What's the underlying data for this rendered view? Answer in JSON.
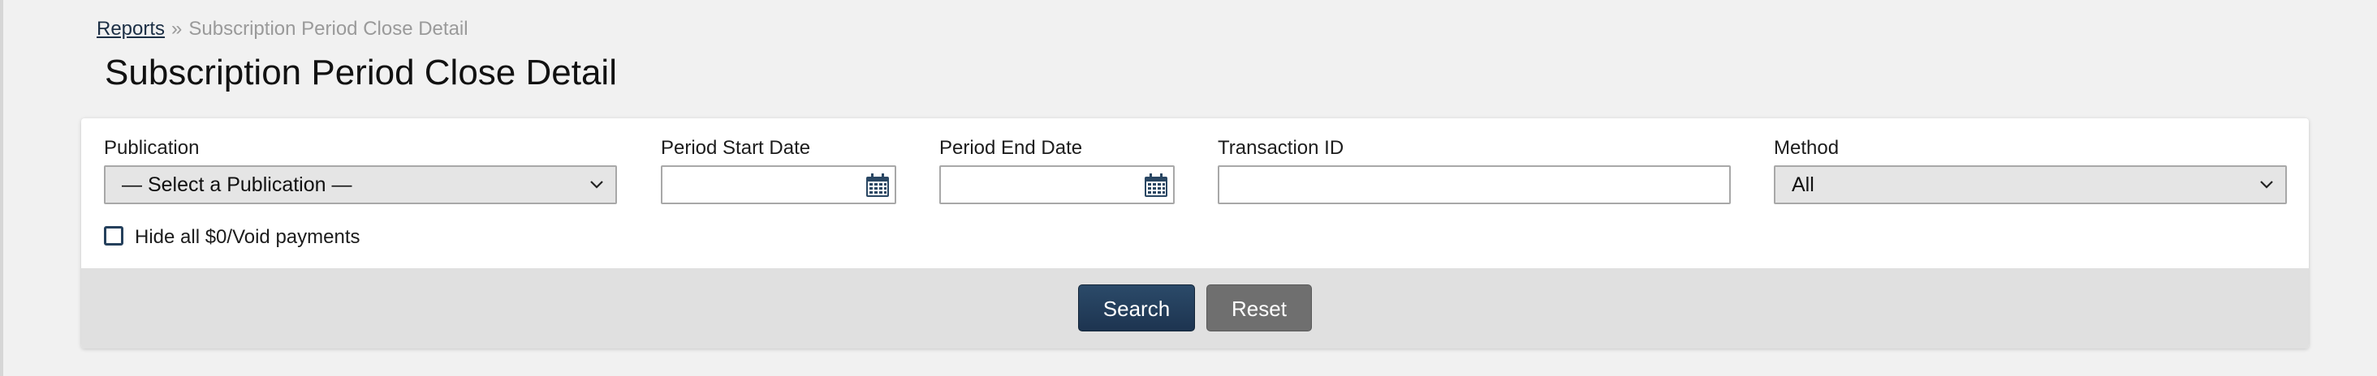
{
  "breadcrumb": {
    "parent_label": "Reports",
    "separator": "»",
    "current_label": "Subscription Period Close Detail"
  },
  "page_title": "Subscription Period Close Detail",
  "filters": {
    "publication": {
      "label": "Publication",
      "selected_value": "— Select a Publication —"
    },
    "period_start_date": {
      "label": "Period Start Date",
      "value": ""
    },
    "period_end_date": {
      "label": "Period End Date",
      "value": ""
    },
    "transaction_id": {
      "label": "Transaction ID",
      "value": ""
    },
    "method": {
      "label": "Method",
      "selected_value": "All"
    },
    "hide_zero_void": {
      "label": "Hide all $0/Void payments",
      "checked": false
    }
  },
  "actions": {
    "search_label": "Search",
    "reset_label": "Reset"
  },
  "icons": {
    "calendar": "calendar-icon",
    "dropdown": "chevron-down-icon"
  },
  "colors": {
    "primary_button": "#1f3a57",
    "secondary_button": "#6f6f6f",
    "page_background": "#f1f1f1",
    "footer_bar": "#e0e0e0",
    "link": "#1c2f45"
  }
}
